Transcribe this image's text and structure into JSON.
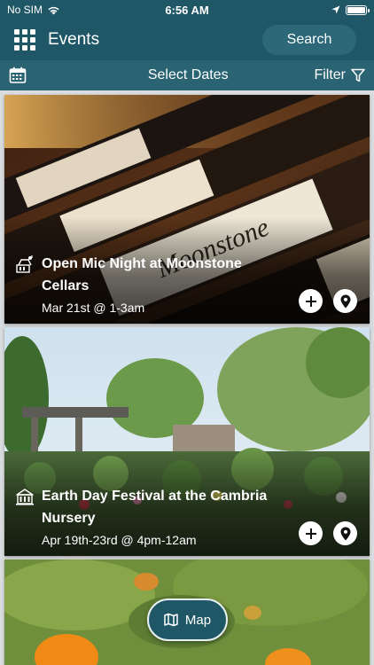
{
  "status_bar": {
    "carrier": "No SIM",
    "time": "6:56 AM"
  },
  "header": {
    "title": "Events",
    "search_label": "Search"
  },
  "subbar": {
    "select_dates_label": "Select Dates",
    "filter_label": "Filter"
  },
  "events": [
    {
      "title": "Open Mic Night at Moonstone Cellars",
      "date": "Mar 21st @ 1-3am",
      "type_icon": "music-icon"
    },
    {
      "title": "Earth Day Festival at the Cambria Nursery",
      "date": "Apr 19th-23rd @ 4pm-12am",
      "type_icon": "building-icon"
    },
    {
      "title": "",
      "date": "",
      "type_icon": ""
    }
  ],
  "map_button": {
    "label": "Map"
  },
  "colors": {
    "header_bg": "#1f5767",
    "subbar_bg": "#2a6473",
    "search_bg": "#2c6878"
  }
}
